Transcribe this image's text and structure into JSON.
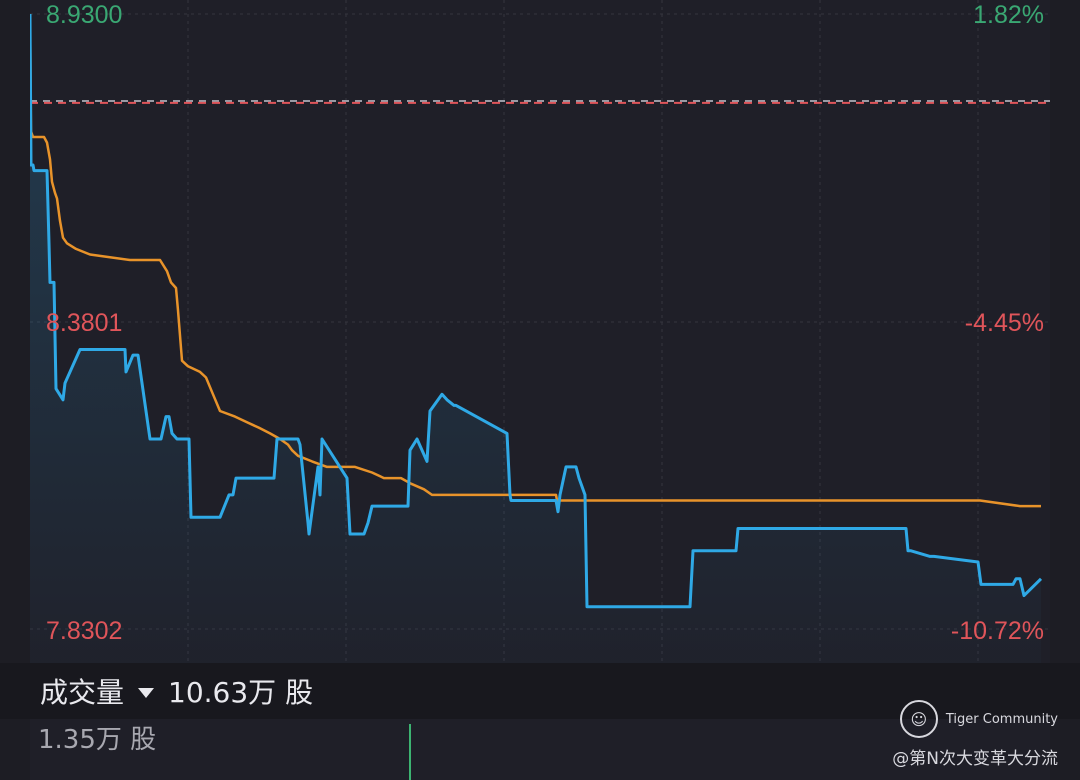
{
  "colors": {
    "price_line": "#2fa9e6",
    "avg_line": "#e8932a",
    "ref_line": "#e0555a",
    "up_text": "#3aa873",
    "down_text": "#e0555a",
    "grid": "#34343e",
    "volume_bar": "#3cb371"
  },
  "chart_data": {
    "type": "line",
    "y_left_labels": [
      "8.9300",
      "8.3801",
      "7.8302"
    ],
    "y_right_labels": [
      "1.82%",
      "-4.45%",
      "-10.72%"
    ],
    "ylim": [
      7.8302,
      8.93
    ],
    "reference_price": 8.771,
    "grid": true,
    "series": [
      {
        "key": "price",
        "x": [
          0,
          1,
          3,
          4,
          17,
          19,
          20,
          24,
          26,
          33,
          35,
          50,
          95,
          96,
          103,
          108,
          120,
          131,
          136,
          139,
          142,
          147,
          159,
          161,
          190,
          199,
          203,
          206,
          244,
          247,
          268,
          270,
          278,
          279,
          288,
          290,
          292,
          317,
          320,
          334,
          338,
          342,
          378,
          380,
          387,
          397,
          400,
          412,
          417,
          424,
          426,
          477,
          480,
          481,
          514,
          526,
          528,
          530,
          536,
          546,
          549,
          555,
          557,
          566,
          660,
          663,
          706,
          708,
          809,
          821,
          876,
          878,
          881,
          900,
          904,
          948,
          951,
          983,
          986,
          990,
          994,
          1011
        ],
        "y": [
          8.93,
          8.66,
          8.66,
          8.65,
          8.65,
          8.52,
          8.45,
          8.45,
          8.26,
          8.24,
          8.27,
          8.33,
          8.33,
          8.29,
          8.32,
          8.32,
          8.17,
          8.17,
          8.21,
          8.21,
          8.18,
          8.17,
          8.17,
          8.03,
          8.03,
          8.07,
          8.07,
          8.1,
          8.1,
          8.17,
          8.17,
          8.16,
          8.02,
          8.0,
          8.12,
          8.07,
          8.17,
          8.1,
          8.0,
          8.0,
          8.02,
          8.05,
          8.05,
          8.15,
          8.17,
          8.13,
          8.22,
          8.25,
          8.24,
          8.23,
          8.23,
          8.18,
          8.07,
          8.06,
          8.06,
          8.06,
          8.04,
          8.07,
          8.12,
          8.12,
          8.1,
          8.07,
          7.87,
          7.87,
          7.87,
          7.97,
          7.97,
          8.01,
          8.01,
          8.01,
          8.01,
          7.97,
          7.97,
          7.96,
          7.96,
          7.95,
          7.91,
          7.91,
          7.92,
          7.92,
          7.89,
          7.92
        ]
      },
      {
        "key": "average",
        "x": [
          0,
          1,
          3,
          14,
          17,
          20,
          22,
          25,
          27,
          30,
          33,
          37,
          46,
          60,
          100,
          130,
          137,
          141,
          146,
          148,
          152,
          158,
          170,
          176,
          183,
          190,
          205,
          217,
          229,
          240,
          250,
          258,
          262,
          268,
          282,
          297,
          312,
          325,
          342,
          354,
          371,
          381,
          394,
          402,
          410,
          417,
          458,
          526,
          527,
          552,
          560,
          661,
          810,
          950,
          990,
          1011
        ],
        "y": [
          8.93,
          8.72,
          8.71,
          8.71,
          8.7,
          8.67,
          8.63,
          8.61,
          8.6,
          8.56,
          8.53,
          8.52,
          8.51,
          8.5,
          8.49,
          8.49,
          8.47,
          8.45,
          8.44,
          8.4,
          8.31,
          8.3,
          8.29,
          8.28,
          8.25,
          8.22,
          8.21,
          8.2,
          8.19,
          8.18,
          8.17,
          8.16,
          8.15,
          8.14,
          8.13,
          8.12,
          8.12,
          8.12,
          8.11,
          8.1,
          8.1,
          8.09,
          8.08,
          8.07,
          8.07,
          8.07,
          8.07,
          8.07,
          8.06,
          8.06,
          8.06,
          8.06,
          8.06,
          8.06,
          8.05,
          8.05
        ]
      }
    ]
  },
  "volume": {
    "label": "成交量",
    "total": "10.63万 股",
    "scale": "1.35万 股"
  },
  "watermark": {
    "brand": "Tiger Community",
    "user": "@第N次大变革大分流"
  }
}
